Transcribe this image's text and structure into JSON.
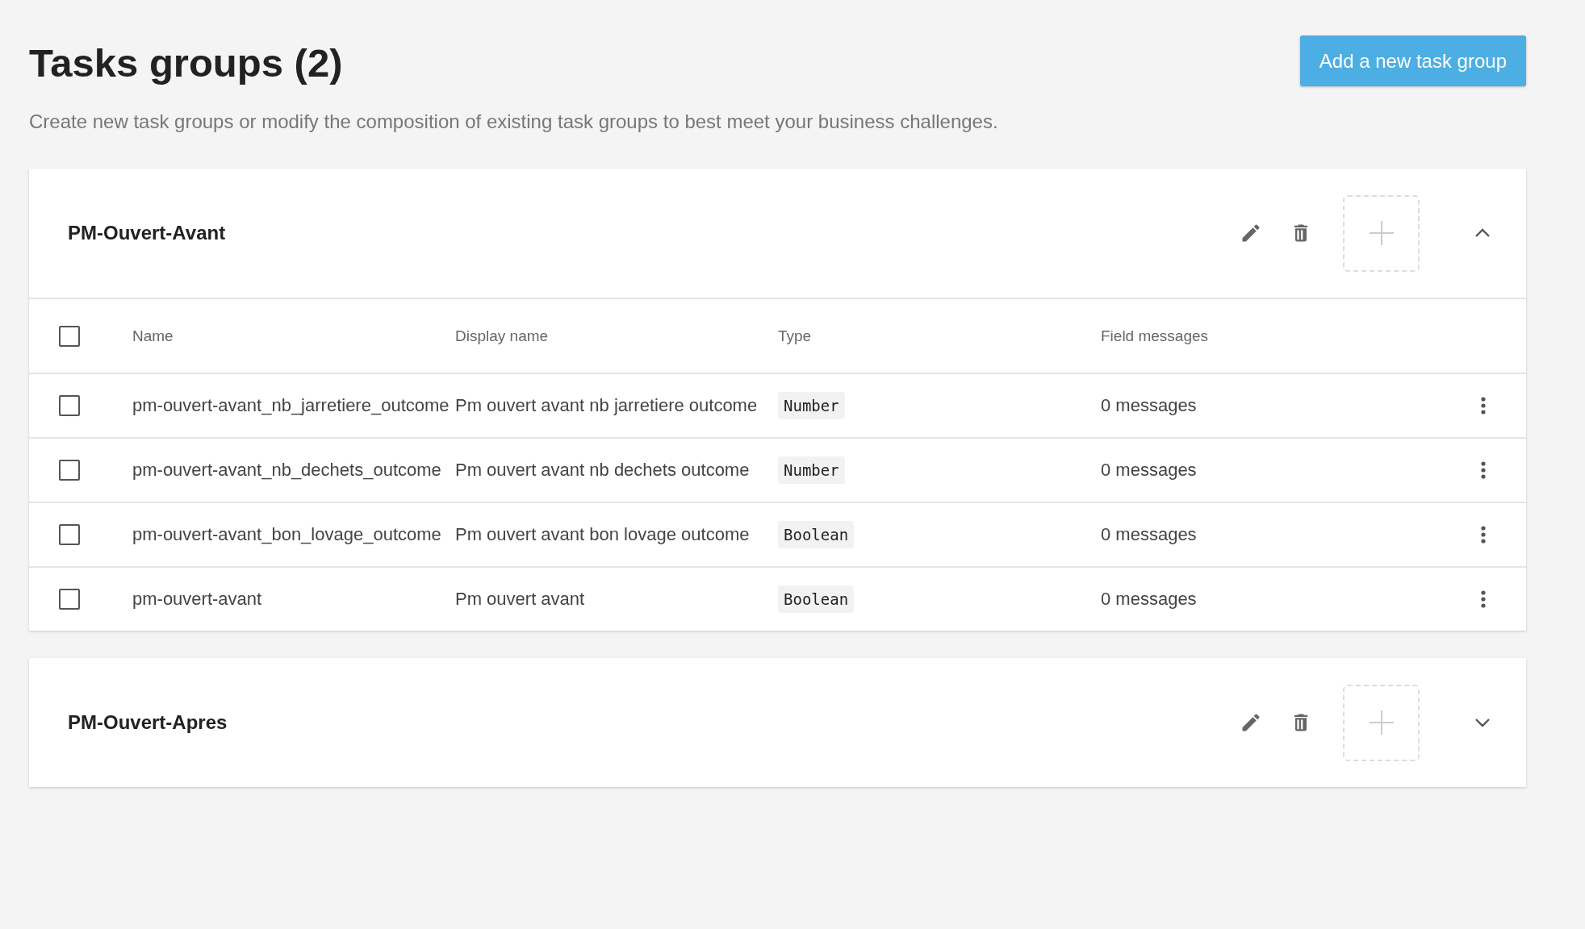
{
  "page": {
    "title": "Tasks groups (2)",
    "description": "Create new task groups or modify the composition of existing task groups to best meet your business challenges.",
    "add_button": "Add a new task group"
  },
  "groups": [
    {
      "name": "PM-Ouvert-Avant",
      "expanded": true,
      "select_all": false,
      "columns": [
        "Name",
        "Display name",
        "Type",
        "Field messages"
      ],
      "rows": [
        {
          "checked": false,
          "name": "pm-ouvert-avant_nb_jarretiere_outcome",
          "display_name": "Pm ouvert avant nb jarretiere outcome",
          "type": "Number",
          "messages": "0 messages"
        },
        {
          "checked": false,
          "name": "pm-ouvert-avant_nb_dechets_outcome",
          "display_name": "Pm ouvert avant nb dechets outcome",
          "type": "Number",
          "messages": "0 messages"
        },
        {
          "checked": false,
          "name": "pm-ouvert-avant_bon_lovage_outcome",
          "display_name": "Pm ouvert avant bon lovage outcome",
          "type": "Boolean",
          "messages": "0 messages"
        },
        {
          "checked": false,
          "name": "pm-ouvert-avant",
          "display_name": "Pm ouvert avant",
          "type": "Boolean",
          "messages": "0 messages"
        }
      ]
    },
    {
      "name": "PM-Ouvert-Apres",
      "expanded": false
    }
  ]
}
